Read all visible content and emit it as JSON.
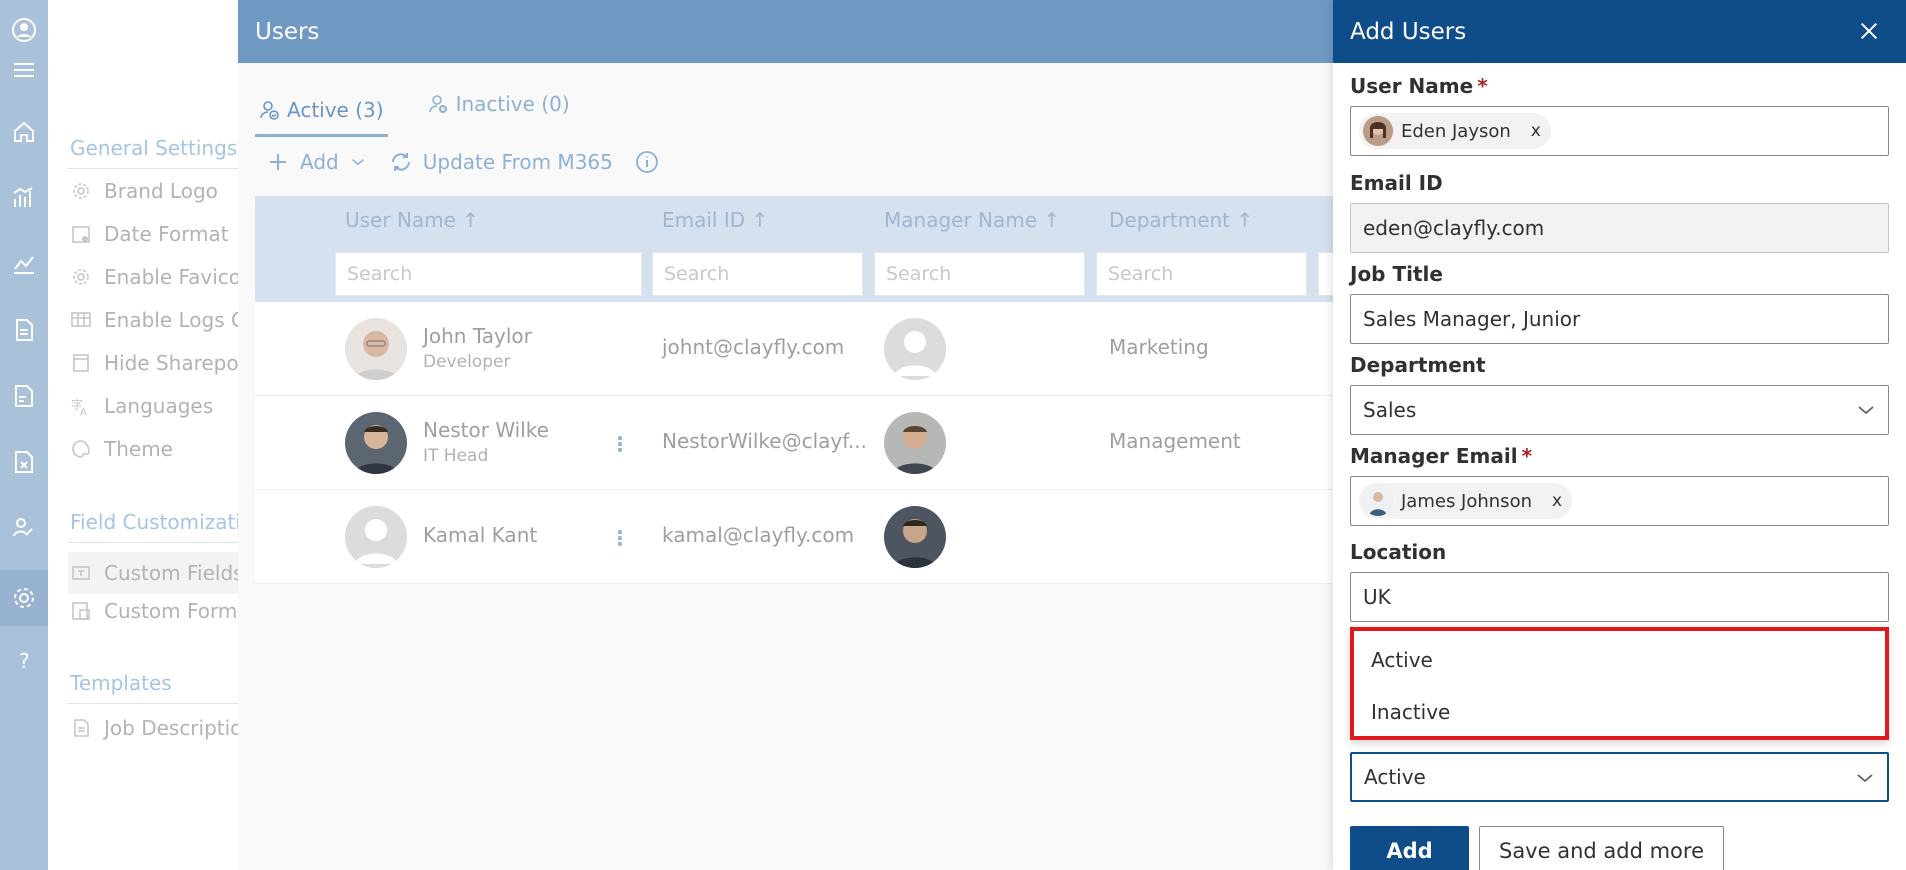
{
  "nav": {
    "section_general": "General Settings",
    "items_general": [
      "Brand Logo",
      "Date Format",
      "Enable Favicon",
      "Enable Logs Co",
      "Hide Sharepoi",
      "Languages",
      "Theme"
    ],
    "section_field": "Field Customizatio",
    "items_field": [
      "Custom Fields",
      "Custom Forms"
    ],
    "section_templates": "Templates",
    "items_templates": [
      "Job Descriptio"
    ]
  },
  "main": {
    "title": "Users",
    "tabs": [
      {
        "label": "Active (3)",
        "active": true
      },
      {
        "label": "Inactive (0)",
        "active": false
      }
    ],
    "commands": {
      "add": "Add",
      "update": "Update From M365"
    },
    "columns": [
      "User Name ↑",
      "Email ID ↑",
      "Manager Name ↑",
      "Department ↑"
    ],
    "search_placeholder": "Search",
    "rows": [
      {
        "name": "John Taylor",
        "title": "Developer",
        "email": "johnt@clayfly.com",
        "department": "Marketing"
      },
      {
        "name": "Nestor Wilke",
        "title": "IT Head",
        "email": "NestorWilke@clayf...",
        "department": "Management"
      },
      {
        "name": "Kamal Kant",
        "title": "",
        "email": "kamal@clayfly.com",
        "department": ""
      }
    ]
  },
  "panel": {
    "title": "Add Users",
    "user_name_label": "User Name",
    "user_name_value": "Eden Jayson",
    "pill_remove": "x",
    "email_label": "Email ID",
    "email_value": "eden@clayfly.com",
    "job_title_label": "Job Title",
    "job_title_value": "Sales Manager, Junior",
    "department_label": "Department",
    "department_value": "Sales",
    "manager_email_label": "Manager Email",
    "manager_value": "James Johnson",
    "location_label": "Location",
    "location_value": "UK",
    "required_mark": "*",
    "status_options": [
      "Active",
      "Inactive"
    ],
    "status_value": "Active",
    "add_button": "Add",
    "save_more_button": "Save and add more"
  },
  "colors": {
    "panel_header": "#0f4c8a",
    "highlight_border": "#e0191f",
    "main_header": "#6f99c3"
  }
}
